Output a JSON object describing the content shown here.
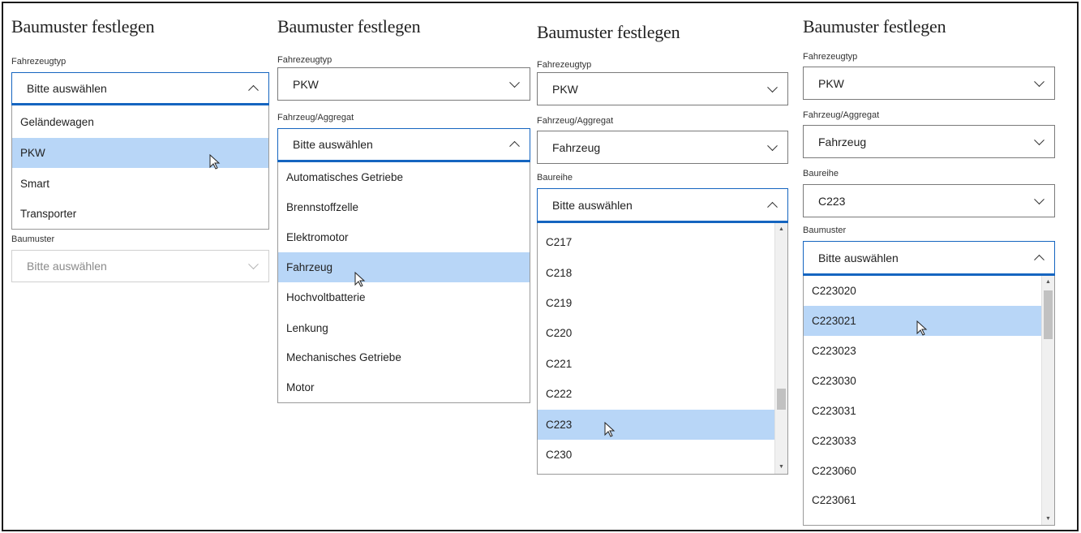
{
  "panels": [
    {
      "title": "Baumuster festlegen",
      "label_vehicle_type": "Fahrezeugtyp",
      "vehicle_type_value": "Bitte auswählen",
      "vehicle_type_options": [
        "Geländewagen",
        "PKW",
        "Smart",
        "Transporter"
      ],
      "vehicle_type_highlighted": "PKW",
      "label_model": "Baumuster",
      "model_value": "Bitte auswählen"
    },
    {
      "title": "Baumuster festlegen",
      "label_vehicle_type": "Fahrezeugtyp",
      "vehicle_type_value": "PKW",
      "label_aggregate": "Fahrzeug/Aggregat",
      "aggregate_value": "Bitte auswählen",
      "aggregate_options": [
        "Automatisches Getriebe",
        "Brennstoffzelle",
        "Elektromotor",
        "Fahrzeug",
        "Hochvoltbatterie",
        "Lenkung",
        "Mechanisches Getriebe",
        "Motor"
      ],
      "aggregate_highlighted": "Fahrzeug"
    },
    {
      "title": "Baumuster festlegen",
      "label_vehicle_type": "Fahrezeugtyp",
      "vehicle_type_value": "PKW",
      "label_aggregate": "Fahrzeug/Aggregat",
      "aggregate_value": "Fahrzeug",
      "label_series": "Baureihe",
      "series_value": "Bitte auswählen",
      "series_options": [
        "C217",
        "C218",
        "C219",
        "C220",
        "C221",
        "C222",
        "C223",
        "C230"
      ],
      "series_highlighted": "C223"
    },
    {
      "title": "Baumuster festlegen",
      "label_vehicle_type": "Fahrezeugtyp",
      "vehicle_type_value": "PKW",
      "label_aggregate": "Fahrzeug/Aggregat",
      "aggregate_value": "Fahrzeug",
      "label_series": "Baureihe",
      "series_value": "C223",
      "label_model": "Baumuster",
      "model_value": "Bitte auswählen",
      "model_options": [
        "C223020",
        "C223021",
        "C223023",
        "C223030",
        "C223031",
        "C223033",
        "C223060",
        "C223061"
      ],
      "model_highlighted": "C223021"
    }
  ],
  "icons": {
    "chevron_down": "chevron-down-icon",
    "chevron_up": "chevron-up-icon",
    "cursor": "mouse-pointer-icon",
    "scroll_up": "scroll-up-arrow-icon",
    "scroll_down": "scroll-down-arrow-icon"
  },
  "colors": {
    "accent": "#1565c0",
    "highlight": "#b8d6f7",
    "border": "#7a7a7a"
  }
}
